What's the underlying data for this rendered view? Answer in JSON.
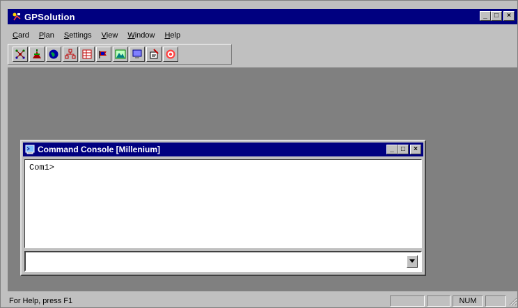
{
  "app": {
    "title": "GPSolution",
    "window_controls": {
      "minimize": "_",
      "maximize": "□",
      "close": "×"
    }
  },
  "menu": [
    {
      "label": "Card",
      "mnemonic": "C",
      "rest": "ard"
    },
    {
      "label": "Plan",
      "mnemonic": "P",
      "rest": "lan"
    },
    {
      "label": "Settings",
      "mnemonic": "S",
      "rest": "ettings"
    },
    {
      "label": "View",
      "mnemonic": "V",
      "rest": "iew"
    },
    {
      "label": "Window",
      "mnemonic": "W",
      "rest": "indow"
    },
    {
      "label": "Help",
      "mnemonic": "H",
      "rest": "elp"
    }
  ],
  "toolbar": {
    "icons": [
      "satellite-network-icon",
      "antenna-icon",
      "globe-icon",
      "network-nodes-icon",
      "table-grid-icon",
      "flag-icon",
      "terrain-icon",
      "monitor-icon",
      "document-sign-icon",
      "target-icon"
    ]
  },
  "console_window": {
    "title": "Command Console [Millenium]",
    "output_text": "Com1>",
    "command_value": ""
  },
  "statusbar": {
    "help_text": "For Help, press F1",
    "num_indicator": "NUM"
  },
  "colors": {
    "titlebar": "#000080",
    "face": "#c0c0c0",
    "mdi_background": "#808080",
    "console_background": "#ffffff"
  }
}
